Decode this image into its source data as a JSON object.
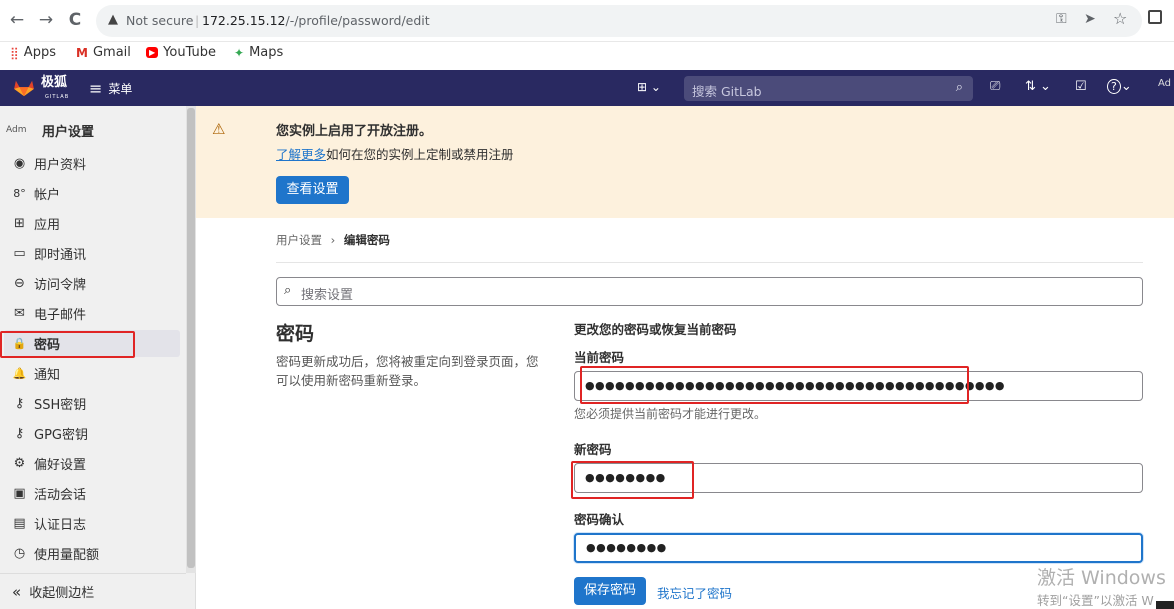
{
  "browser": {
    "back_icon": "←",
    "forward_icon": "→",
    "reload_icon": "C",
    "security_warning_icon": "▲",
    "security_text": "Not secure",
    "separator": "|",
    "url_host": "172.25.15.12",
    "url_path": "/-/profile/password/edit",
    "key_icon": "⚿",
    "share_icon": "➤",
    "star_icon": "☆"
  },
  "bookmarks": [
    {
      "icon": "⣿",
      "label": "Apps",
      "color": "#e8453c"
    },
    {
      "icon": "M",
      "label": "Gmail",
      "color": "#d93025"
    },
    {
      "icon": "▶",
      "label": "YouTube",
      "color": "#ff0000"
    },
    {
      "icon": "✦",
      "label": "Maps",
      "color": "#34a853"
    }
  ],
  "gitlab_header": {
    "brand": "极狐",
    "brand_sub": "GITLAB",
    "menu_icon": "≡",
    "menu_label": "菜单",
    "new_icon": "⊞",
    "chevron": "⌄",
    "search_placeholder": "搜索 GitLab",
    "search_icon": "⌕",
    "issues_icon": "⎚",
    "mr_icon": "⇅",
    "todo_icon": "☑",
    "help_icon": "?",
    "avatar_text": "Ad",
    "accent_color": "#292961"
  },
  "sidebar": {
    "avatar_text": "Adm",
    "title": "用户设置",
    "items": [
      {
        "icon": "◉",
        "label": "用户资料"
      },
      {
        "icon": "8°",
        "label": "帐户"
      },
      {
        "icon": "⊞",
        "label": "应用"
      },
      {
        "icon": "▭",
        "label": "即时通讯"
      },
      {
        "icon": "⊖",
        "label": "访问令牌"
      },
      {
        "icon": "✉",
        "label": "电子邮件"
      },
      {
        "icon": "🔒",
        "label": "密码"
      },
      {
        "icon": "🔔",
        "label": "通知"
      },
      {
        "icon": "⚷",
        "label": "SSH密钥"
      },
      {
        "icon": "⚷",
        "label": "GPG密钥"
      },
      {
        "icon": "⚙",
        "label": "偏好设置"
      },
      {
        "icon": "▣",
        "label": "活动会话"
      },
      {
        "icon": "▤",
        "label": "认证日志"
      },
      {
        "icon": "◷",
        "label": "使用量配额"
      }
    ],
    "active_index": 6,
    "collapse_icon": "«",
    "collapse_label": "收起侧边栏"
  },
  "banner": {
    "warning_icon": "⚠",
    "title": "您实例上启用了开放注册。",
    "learn_more": "了解更多",
    "text": "如何在您的实例上定制或禁用注册",
    "button": "查看设置"
  },
  "breadcrumb": {
    "parent": "用户设置",
    "separator": "›",
    "current": "编辑密码"
  },
  "search_settings": {
    "icon": "⌕",
    "placeholder": "搜索设置"
  },
  "section": {
    "title": "密码",
    "description": "密码更新成功后，您将被重定向到登录页面，您可以使用新密码重新登录。"
  },
  "form": {
    "heading": "更改您的密码或恢复当前密码",
    "current_label": "当前密码",
    "current_value": "●●●●●●●●●●●●●●●●●●●●●●●●●●●●●●●●●●●●●●●●●●",
    "current_hint": "您必须提供当前密码才能进行更改。",
    "new_label": "新密码",
    "new_value": "●●●●●●●●",
    "confirm_label": "密码确认",
    "confirm_value": "●●●●●●●●",
    "save_button": "保存密码",
    "forgot_link": "我忘记了密码"
  },
  "watermark": {
    "line1": "激活 Windows",
    "line2": "转到“设置”以激活 W"
  }
}
